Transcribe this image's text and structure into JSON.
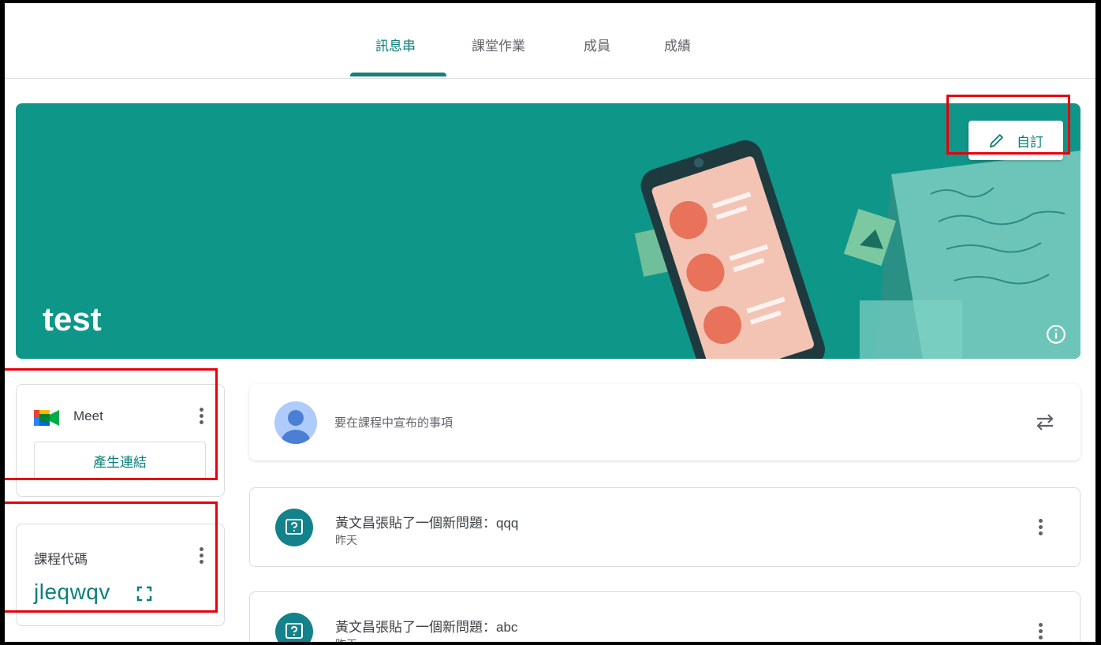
{
  "nav": {
    "tabs": [
      {
        "label": "訊息串",
        "active": true
      },
      {
        "label": "課堂作業",
        "active": false
      },
      {
        "label": "成員",
        "active": false
      },
      {
        "label": "成績",
        "active": false
      }
    ]
  },
  "banner": {
    "title": "test",
    "customize_label": "自訂",
    "color": "#0e9688"
  },
  "meet": {
    "label": "Meet",
    "button_label": "產生連結"
  },
  "class_code": {
    "label": "課程代碼",
    "value": "jleqwqv"
  },
  "announce": {
    "placeholder": "要在課程中宣布的事項"
  },
  "posts": [
    {
      "title": "黃文昌張貼了一個新問題：qqq",
      "time": "昨天"
    },
    {
      "title": "黃文昌張貼了一個新問題：abc",
      "time": "昨天"
    }
  ],
  "colors": {
    "accent": "#0b8079",
    "highlight": "#e8000b"
  }
}
